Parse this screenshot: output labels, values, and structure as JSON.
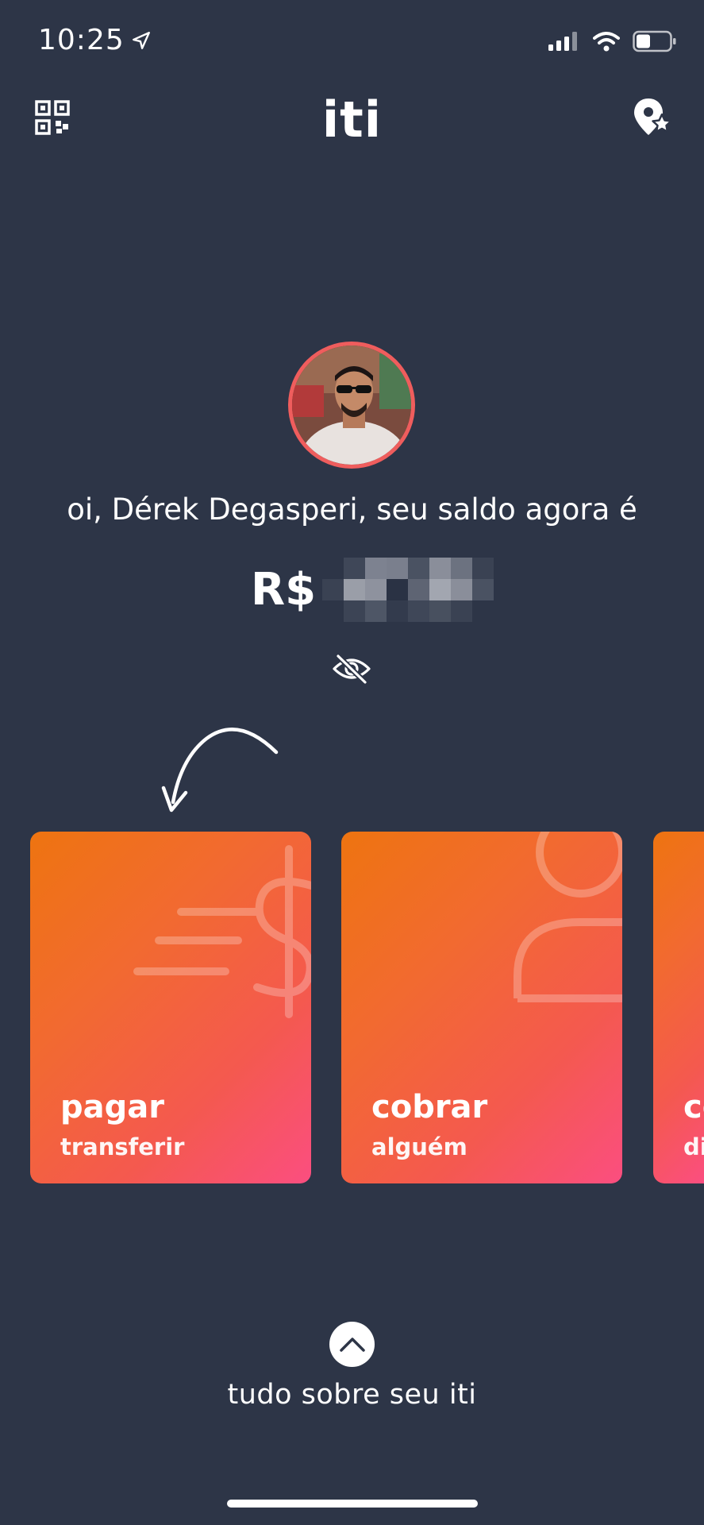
{
  "status_bar": {
    "time": "10:25",
    "icons": [
      "location-arrow-icon",
      "cellular-signal-icon",
      "wifi-icon",
      "battery-icon"
    ]
  },
  "header": {
    "logo": "iti",
    "left_icon": "qr-code-icon",
    "right_icon": "location-star-icon"
  },
  "profile": {
    "greeting": "oi, Dérek Degasperi, seu saldo agora é",
    "balance_prefix": "R$",
    "balance_masked": true,
    "toggle_icon": "eye-off-icon"
  },
  "cards": [
    {
      "title": "pagar",
      "subtitle": "transferir",
      "icon": "money-transfer-icon"
    },
    {
      "title": "cobrar",
      "subtitle": "alguém",
      "icon": "person-icon"
    },
    {
      "title": "co",
      "subtitle": "di",
      "icon": ""
    }
  ],
  "footer": {
    "expand_icon": "chevron-up-icon",
    "label": "tudo sobre seu iti"
  },
  "colors": {
    "background": "#2d3547",
    "card_gradient_start": "#ee7410",
    "card_gradient_end": "#fb4e80",
    "avatar_ring": "#ef5d5d"
  }
}
